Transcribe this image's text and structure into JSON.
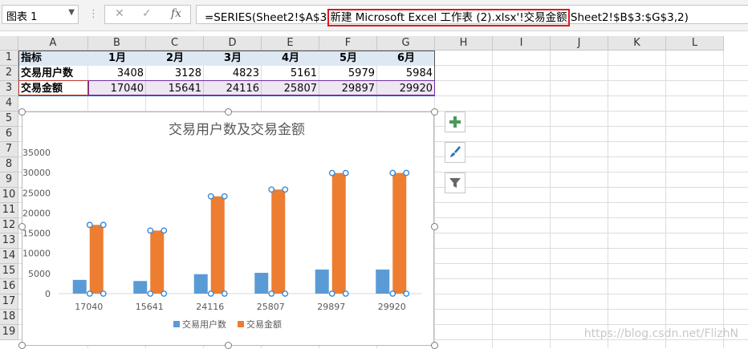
{
  "name_box": {
    "value": "图表 1"
  },
  "formula_bar": {
    "prefix": "=SERIES(Sheet2!$A$3,",
    "highlighted": "新建 Microsoft Excel 工作表 (2).xlsx'!交易金额",
    "suffix": ",Sheet2!$B$3:$G$3,2)",
    "highlight_color": "#e0191f"
  },
  "columns": [
    "A",
    "B",
    "C",
    "D",
    "E",
    "F",
    "G",
    "H",
    "I",
    "J",
    "K",
    "L"
  ],
  "rows": [
    "1",
    "2",
    "3",
    "4",
    "5",
    "6",
    "7",
    "8",
    "9",
    "10",
    "11",
    "12",
    "13",
    "14",
    "15",
    "16",
    "17",
    "18",
    "19"
  ],
  "table": {
    "row1": [
      "指标",
      "1月",
      "2月",
      "3月",
      "4月",
      "5月",
      "6月"
    ],
    "row2": [
      "交易用户数",
      "3408",
      "3128",
      "4823",
      "5161",
      "5979",
      "5984"
    ],
    "row3": [
      "交易金额",
      "17040",
      "15641",
      "24116",
      "25807",
      "29897",
      "29920"
    ]
  },
  "chart_data": {
    "type": "bar",
    "title": "交易用户数及交易金额",
    "categories": [
      "17040",
      "15641",
      "24116",
      "25807",
      "29897",
      "29920"
    ],
    "series": [
      {
        "name": "交易用户数",
        "values": [
          3408,
          3128,
          4823,
          5161,
          5979,
          5984
        ],
        "color": "#5b9bd5"
      },
      {
        "name": "交易金额",
        "values": [
          17040,
          15641,
          24116,
          25807,
          29897,
          29920
        ],
        "color": "#ed7d31"
      }
    ],
    "yticks": [
      "0",
      "5000",
      "10000",
      "15000",
      "20000",
      "25000",
      "30000",
      "35000"
    ],
    "ylim": [
      0,
      35000
    ],
    "legend": "bottom",
    "grid": false
  },
  "watermark": "https://blog.csdn.net/FlizhN",
  "colors": {
    "header_fill": "#dde8f4",
    "selection_purple": "#7030a0",
    "add_icon": "#3e8e41"
  }
}
